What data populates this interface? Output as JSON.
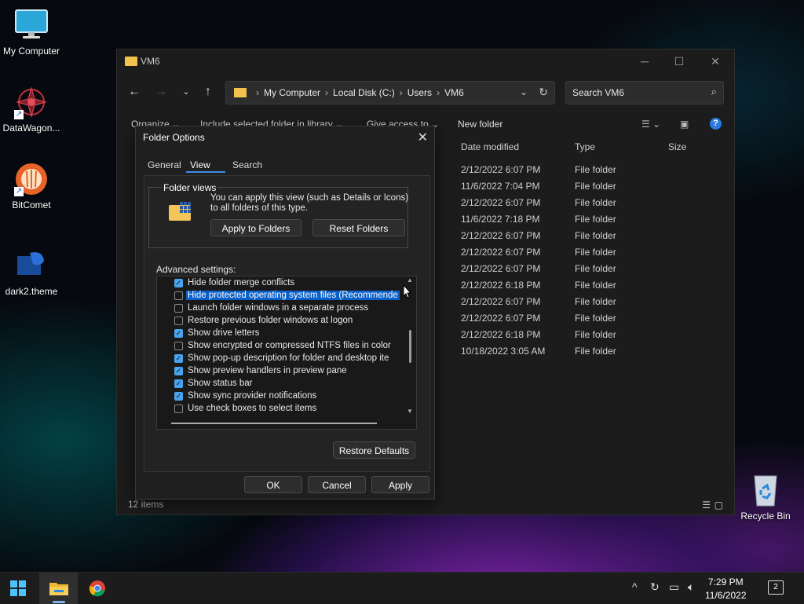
{
  "desktop": {
    "icons": [
      {
        "label": "My Computer"
      },
      {
        "label": "DataWagon..."
      },
      {
        "label": "BitComet"
      },
      {
        "label": "dark2.theme"
      },
      {
        "label": "Recycle Bin"
      }
    ]
  },
  "explorer": {
    "title": "VM6",
    "breadcrumbs": [
      "My Computer",
      "Local Disk (C:)",
      "Users",
      "VM6"
    ],
    "search_placeholder": "Search VM6",
    "toolbar": {
      "organize": "Organize",
      "include": "Include selected folder in library",
      "give_access": "Give access to",
      "new_folder": "New folder"
    },
    "columns": {
      "date": "Date modified",
      "type": "Type",
      "size": "Size"
    },
    "rows": [
      {
        "date": "2/12/2022 6:07 PM",
        "type": "File folder"
      },
      {
        "date": "11/6/2022 7:04 PM",
        "type": "File folder"
      },
      {
        "date": "2/12/2022 6:07 PM",
        "type": "File folder"
      },
      {
        "date": "11/6/2022 7:18 PM",
        "type": "File folder"
      },
      {
        "date": "2/12/2022 6:07 PM",
        "type": "File folder"
      },
      {
        "date": "2/12/2022 6:07 PM",
        "type": "File folder"
      },
      {
        "date": "2/12/2022 6:07 PM",
        "type": "File folder"
      },
      {
        "date": "2/12/2022 6:18 PM",
        "type": "File folder"
      },
      {
        "date": "2/12/2022 6:07 PM",
        "type": "File folder"
      },
      {
        "date": "2/12/2022 6:07 PM",
        "type": "File folder"
      },
      {
        "date": "2/12/2022 6:18 PM",
        "type": "File folder"
      },
      {
        "date": "10/18/2022 3:05 AM",
        "type": "File folder"
      }
    ],
    "status": "12 items"
  },
  "dialog": {
    "title": "Folder Options",
    "tabs": [
      "General",
      "View",
      "Search"
    ],
    "active_tab": "View",
    "folder_views": {
      "label": "Folder views",
      "text": "You can apply this view (such as Details or Icons) to all folders of this type.",
      "apply_label": "Apply to Folders",
      "reset_label": "Reset Folders"
    },
    "advanced_label": "Advanced settings:",
    "settings": [
      {
        "label": "Hide folder merge conflicts",
        "checked": true
      },
      {
        "label": "Hide protected operating system files (Recommende",
        "checked": false,
        "selected": true
      },
      {
        "label": "Launch folder windows in a separate process",
        "checked": false
      },
      {
        "label": "Restore previous folder windows at logon",
        "checked": false
      },
      {
        "label": "Show drive letters",
        "checked": true
      },
      {
        "label": "Show encrypted or compressed NTFS files in color",
        "checked": false
      },
      {
        "label": "Show pop-up description for folder and desktop ite",
        "checked": true
      },
      {
        "label": "Show preview handlers in preview pane",
        "checked": true
      },
      {
        "label": "Show status bar",
        "checked": true
      },
      {
        "label": "Show sync provider notifications",
        "checked": true
      },
      {
        "label": "Use check boxes to select items",
        "checked": false
      }
    ],
    "restore_label": "Restore Defaults",
    "ok_label": "OK",
    "cancel_label": "Cancel",
    "apply_label": "Apply"
  },
  "taskbar": {
    "time": "7:29 PM",
    "date": "11/6/2022",
    "notifications": "2"
  },
  "icons": {
    "folder": "folder-icon",
    "search": "search-icon",
    "help": "help-icon",
    "windows": "windows-start-icon",
    "chrome": "chrome-icon"
  },
  "colors": {
    "accent": "#3b8ee8",
    "selection": "#0a5fc8",
    "folder": "#f2c14e",
    "checkbox_on": "#4aa3f0"
  }
}
